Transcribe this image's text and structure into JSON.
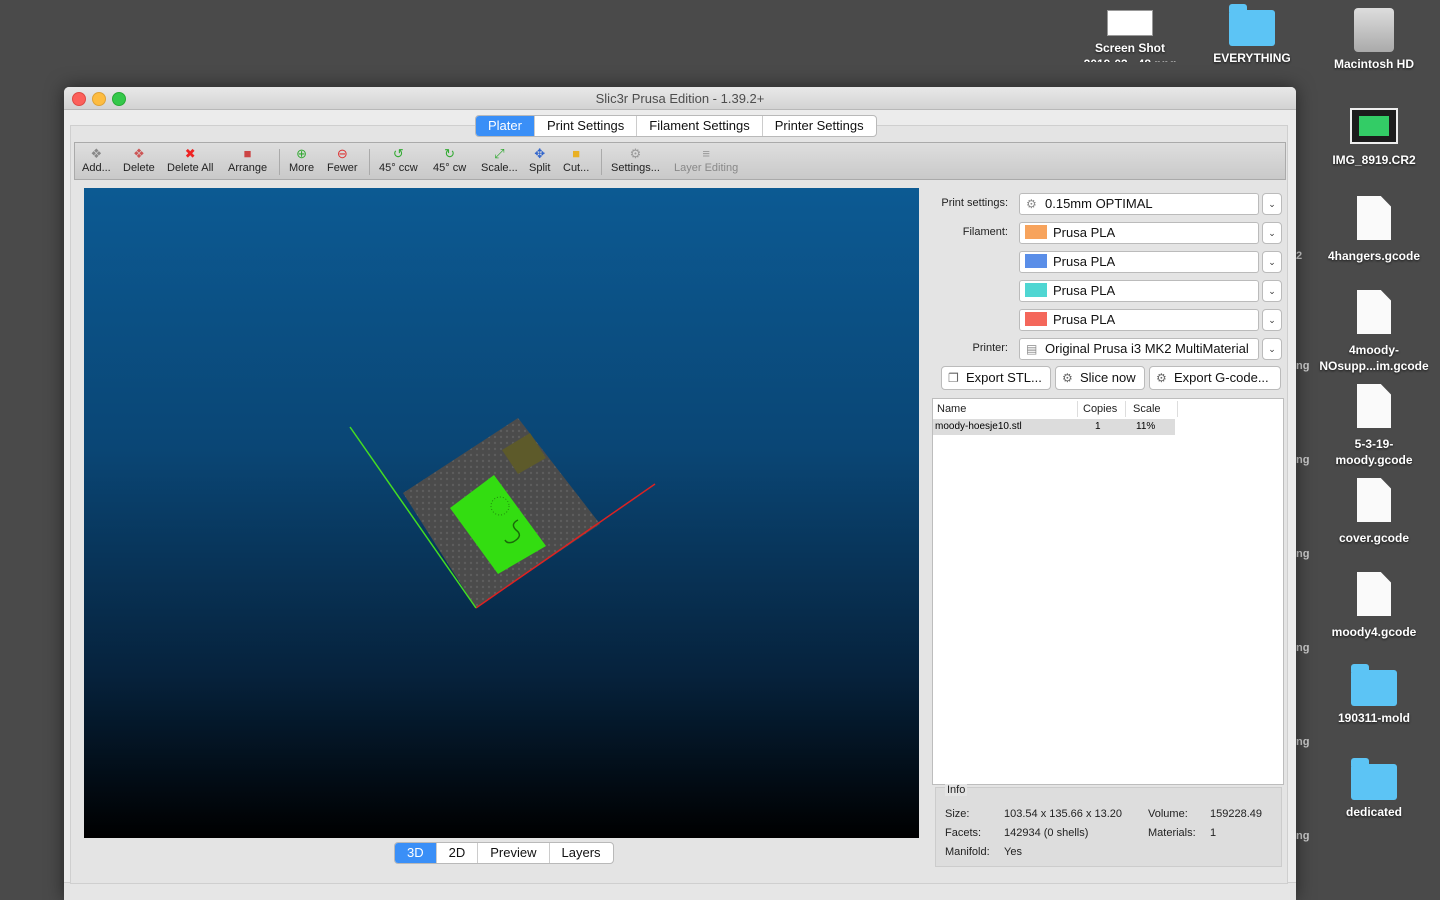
{
  "desktop": {
    "icons": [
      {
        "name": "screenshot-file-icon",
        "label": "Screen Shot\n2019-03...48.png",
        "kind": "shot"
      },
      {
        "name": "everything-folder-icon",
        "label": "EVERYTHING",
        "kind": "folder"
      },
      {
        "name": "macintosh-hd-icon",
        "label": "Macintosh HD",
        "kind": "disk"
      },
      {
        "name": "img-8919-file-icon",
        "label": "IMG_8919.CR2",
        "kind": "cr2"
      },
      {
        "name": "4hangers-file-icon",
        "label": "4hangers.gcode",
        "kind": "file"
      },
      {
        "name": "4moody-file-icon",
        "label": "4moody-\nNOsupp...im.gcode",
        "kind": "file"
      },
      {
        "name": "5-3-19-file-icon",
        "label": "5-3-19-\nmoody.gcode",
        "kind": "file"
      },
      {
        "name": "cover-file-icon",
        "label": "cover.gcode",
        "kind": "file"
      },
      {
        "name": "moody4-file-icon",
        "label": "moody4.gcode",
        "kind": "file"
      },
      {
        "name": "190311-mold-folder-icon",
        "label": "190311-mold",
        "kind": "folder"
      },
      {
        "name": "dedicated-folder-icon",
        "label": "dedicated",
        "kind": "folder"
      }
    ],
    "clipped": [
      "2",
      "ng",
      "ng",
      "ng",
      "ng",
      "ng",
      "ng"
    ]
  },
  "window": {
    "title": "Slic3r Prusa Edition - 1.39.2+",
    "tabs": [
      "Plater",
      "Print Settings",
      "Filament Settings",
      "Printer Settings"
    ],
    "active_tab": "Plater",
    "toolbar": {
      "add": "Add...",
      "delete": "Delete",
      "delete_all": "Delete All",
      "arrange": "Arrange",
      "more": "More",
      "fewer": "Fewer",
      "rotate_ccw": "45° ccw",
      "rotate_cw": "45° cw",
      "scale": "Scale...",
      "split": "Split",
      "cut": "Cut...",
      "settings": "Settings...",
      "layer_editing": "Layer Editing"
    },
    "view_tabs": [
      "3D",
      "2D",
      "Preview",
      "Layers"
    ],
    "active_view": "3D"
  },
  "sidebar": {
    "print_settings_label": "Print settings:",
    "print_settings_value": "0.15mm OPTIMAL",
    "filament_label": "Filament:",
    "filaments": [
      {
        "name": "Prusa PLA",
        "color": "#f7a35c"
      },
      {
        "name": "Prusa PLA",
        "color": "#5a8ee8"
      },
      {
        "name": "Prusa PLA",
        "color": "#4fd6d2"
      },
      {
        "name": "Prusa PLA",
        "color": "#f4675b"
      }
    ],
    "printer_label": "Printer:",
    "printer_value": "Original Prusa i3 MK2 MultiMaterial",
    "export_stl": "Export STL...",
    "slice_now": "Slice now",
    "export_gcode": "Export G-code...",
    "object_list": {
      "headers": {
        "name": "Name",
        "copies": "Copies",
        "scale": "Scale"
      },
      "rows": [
        {
          "name": "moody-hoesje10.stl",
          "copies": "1",
          "scale": "11%"
        }
      ]
    },
    "info": {
      "title": "Info",
      "size_label": "Size:",
      "size": "103.54 x 135.66 x 13.20",
      "volume_label": "Volume:",
      "volume": "159228.49",
      "facets_label": "Facets:",
      "facets": "142934 (0 shells)",
      "materials_label": "Materials:",
      "materials": "1",
      "manifold_label": "Manifold:",
      "manifold": "Yes"
    }
  },
  "colors": {
    "accent": "#3a8ff7",
    "model_green": "#33dd11",
    "axis_x": "#dd2222",
    "axis_y": "#44dd22"
  }
}
